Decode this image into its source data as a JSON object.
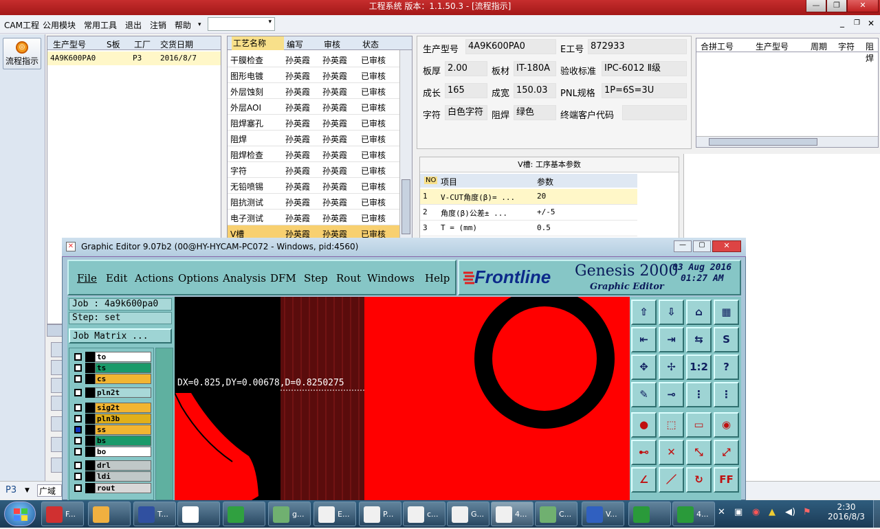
{
  "window": {
    "title": "工程系统  版本：1.1.50.3 - [流程指示]"
  },
  "menu": {
    "items": [
      "CAM工程",
      "公用模块",
      "常用工具",
      "退出",
      "注销",
      "帮助"
    ],
    "dropdown_arrow": "▾"
  },
  "left_nav": {
    "flow_button": "流程指示"
  },
  "job_table": {
    "headers": [
      "生产型号",
      "S板",
      "工厂",
      "交货日期"
    ],
    "rows": [
      [
        "4A9K600PA0",
        "",
        "P3",
        "2016/8/7"
      ]
    ]
  },
  "process_table": {
    "headers": [
      "工艺名称",
      "编写",
      "审核",
      "状态"
    ],
    "rows": [
      [
        "干膜检查",
        "孙英霞",
        "孙英霞",
        "已审核"
      ],
      [
        "图形电镀",
        "孙英霞",
        "孙英霞",
        "已审核"
      ],
      [
        "外层蚀刻",
        "孙英霞",
        "孙英霞",
        "已审核"
      ],
      [
        "外层AOI",
        "孙英霞",
        "孙英霞",
        "已审核"
      ],
      [
        "阻焊塞孔",
        "孙英霞",
        "孙英霞",
        "已审核"
      ],
      [
        "阻焊",
        "孙英霞",
        "孙英霞",
        "已审核"
      ],
      [
        "阻焊检查",
        "孙英霞",
        "孙英霞",
        "已审核"
      ],
      [
        "字符",
        "孙英霞",
        "孙英霞",
        "已审核"
      ],
      [
        "无铅喷锡",
        "孙英霞",
        "孙英霞",
        "已审核"
      ],
      [
        "阻抗测试",
        "孙英霞",
        "孙英霞",
        "已审核"
      ],
      [
        "电子测试",
        "孙英霞",
        "孙英霞",
        "已审核"
      ],
      [
        "V槽",
        "孙英霞",
        "孙英霞",
        "已审核"
      ]
    ],
    "selected_index": 11
  },
  "info": {
    "labels": {
      "model": "生产型号",
      "e_no": "E工号",
      "thickness": "板厚",
      "material": "板材",
      "standard": "验收标准",
      "len": "成长",
      "wid": "成宽",
      "pnl": "PNL规格",
      "char": "字符",
      "mask": "阻焊",
      "customer": "终端客户代码"
    },
    "values": {
      "model": "4A9K600PA0",
      "e_no": "872933",
      "thickness": "2.00",
      "material": "IT-180A",
      "standard": "IPC-6012 Ⅱ级",
      "len": "165",
      "wid": "150.03",
      "pnl": "1P=6S=3U",
      "char": "白色字符",
      "mask": "绿色",
      "customer": ""
    }
  },
  "merge_table": {
    "headers": [
      "合拼工号",
      "生产型号",
      "周期",
      "字符",
      "阻焊"
    ]
  },
  "v_params": {
    "title": "V槽: 工序基本参数",
    "headers": [
      "NO",
      "项目",
      "参数"
    ],
    "rows": [
      [
        "1",
        "V-CUT角度(β)=   ...",
        "20"
      ],
      [
        "2",
        "角度(β)公差±   ...",
        "+/-5"
      ],
      [
        "3",
        "T =  (mm)",
        "0.5"
      ]
    ]
  },
  "bottom": {
    "site": "P3",
    "site_label": "广域"
  },
  "genesis": {
    "title": "Graphic Editor 9.07b2 (00@HY-HYCAM-PC072 - Windows, pid:4560)",
    "menu": [
      "File",
      "Edit",
      "Actions",
      "Options",
      "Analysis",
      "DFM",
      "Step",
      "Rout",
      "Windows",
      "Help"
    ],
    "brand": "Frontline",
    "product": "Genesis 2000",
    "subtitle": "Graphic Editor",
    "date": "03 Aug 2016",
    "time": "01:27 AM",
    "job": "Job : 4a9k600pa0",
    "step": "Step: set",
    "job_matrix": "Job Matrix ...",
    "layers": [
      {
        "name": "to",
        "color": "#ffffff"
      },
      {
        "name": "ts",
        "color": "#1a9a6a"
      },
      {
        "name": "cs",
        "color": "#f2b531"
      },
      {
        "name": "pln2t",
        "color": "#a8d8d8"
      },
      {
        "name": "sig2t",
        "color": "#f2b531"
      },
      {
        "name": "pln3b",
        "color": "#e1b01a"
      },
      {
        "name": "ss",
        "color": "#f2b531"
      },
      {
        "name": "bs",
        "color": "#1a9a6a"
      },
      {
        "name": "bo",
        "color": "#ffffff"
      },
      {
        "name": "drl",
        "color": "#c0c8c8"
      },
      {
        "name": "ldi",
        "color": "#c0c8c8"
      },
      {
        "name": "rout",
        "color": "#d8d8d8"
      }
    ],
    "measure": "DX=0.825,DY=0.00678,D=0.8250275"
  },
  "taskbar": {
    "items": [
      "F...",
      "",
      "T...",
      "",
      "",
      "g...",
      "E...",
      "P...",
      "c...",
      "G...",
      "4...",
      "C...",
      "V...",
      "",
      "4..."
    ],
    "clock_time": "2:30",
    "clock_date": "2016/8/3"
  },
  "colors": {
    "accent": "#c62e2e",
    "cam_red": "#ff0000",
    "cam_teal": "#86c6c6"
  }
}
